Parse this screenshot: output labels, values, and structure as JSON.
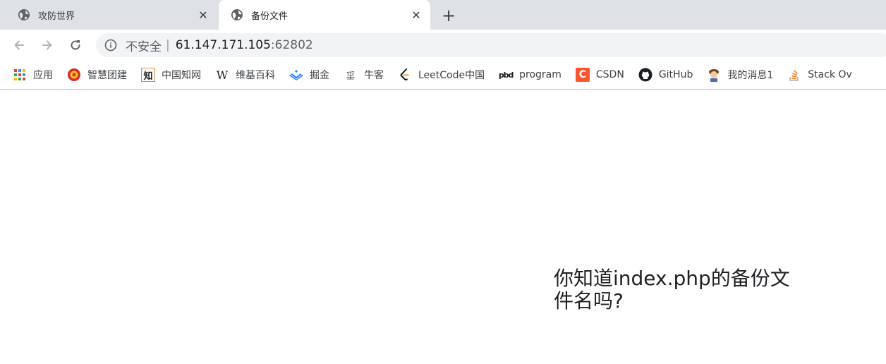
{
  "tabs": [
    {
      "title": "攻防世界",
      "active": false
    },
    {
      "title": "备份文件",
      "active": true
    }
  ],
  "address": {
    "insecure_label": "不安全",
    "separator": "|",
    "host": "61.147.171.105",
    "port": ":62802"
  },
  "bookmarks": [
    {
      "label": "应用",
      "icon": "apps-grid-icon"
    },
    {
      "label": "智慧团建",
      "icon": "league-emblem-icon"
    },
    {
      "label": "中国知网",
      "icon": "cnki-icon"
    },
    {
      "label": "维基百科",
      "icon": "wikipedia-icon"
    },
    {
      "label": "掘金",
      "icon": "juejin-icon"
    },
    {
      "label": "牛客",
      "icon": "nowcoder-icon"
    },
    {
      "label": "LeetCode中国",
      "icon": "leetcode-icon"
    },
    {
      "label": "program",
      "icon": "pbd-icon"
    },
    {
      "label": "CSDN",
      "icon": "csdn-icon"
    },
    {
      "label": "GitHub",
      "icon": "github-icon"
    },
    {
      "label": "我的消息1",
      "icon": "avatar-icon"
    },
    {
      "label": "Stack Ov",
      "icon": "stackoverflow-icon"
    }
  ],
  "page": {
    "question": "你知道index.php的备份文件名吗?"
  },
  "colors": {
    "tabstrip": "#dee1e6",
    "omnibox": "#f1f3f4",
    "csdn": "#fc5531",
    "juejin": "#1e80ff",
    "stackoverflow": "#f48024"
  }
}
